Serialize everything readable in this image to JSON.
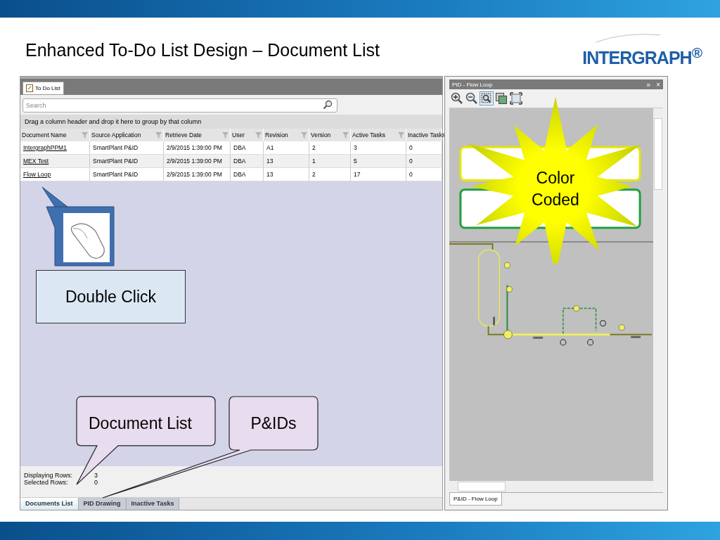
{
  "slide": {
    "title": "Enhanced To-Do List Design – Document List",
    "logo": "INTERGRAPH$^{®}$"
  },
  "todo_window": {
    "tab": "To Do List",
    "search": {
      "placeholder": "Search"
    },
    "group_hint": "Drag a column header and drop it here to group by that column",
    "columns": [
      "Document Name",
      "Source Application",
      "Retrieve Date",
      "User",
      "Revision",
      "Version",
      "Active Tasks",
      "Inactive Tasks"
    ],
    "rows": [
      {
        "cells": [
          "IntergraphPPM1",
          "SmartPlant P&ID",
          "2/9/2015 1:39:00 PM",
          "DBA",
          "A1",
          "2",
          "3",
          "0"
        ]
      },
      {
        "cells": [
          "MEX Test",
          "SmartPlant P&ID",
          "2/9/2015 1:39:00 PM",
          "DBA",
          "13",
          "1",
          "5",
          "0"
        ]
      },
      {
        "cells": [
          "Flow Loop",
          "SmartPlant P&ID",
          "2/9/2015 1:39:00 PM",
          "DBA",
          "13",
          "2",
          "17",
          "0"
        ]
      }
    ],
    "status": [
      {
        "label": "Displaying Rows:",
        "value": "3"
      },
      {
        "label": "Selected Rows:",
        "value": "0"
      }
    ],
    "bottom_tabs": [
      {
        "label": "Documents List",
        "selected": true
      },
      {
        "label": "PID Drawing",
        "selected": false
      },
      {
        "label": "Inactive Tasks",
        "selected": false
      }
    ]
  },
  "pid_panel": {
    "title": "PID - Flow Loop",
    "pin": "»",
    "close": "×",
    "tab": "P&ID - Flow Loop"
  },
  "callouts": [
    {
      "kind": "mouse"
    },
    {
      "kind": "box",
      "text": "Double Click"
    },
    {
      "kind": "bubble",
      "text": "Document List"
    },
    {
      "kind": "bubble",
      "text": "P&IDs"
    },
    {
      "kind": "starburst",
      "text": "Color Coded"
    }
  ]
}
